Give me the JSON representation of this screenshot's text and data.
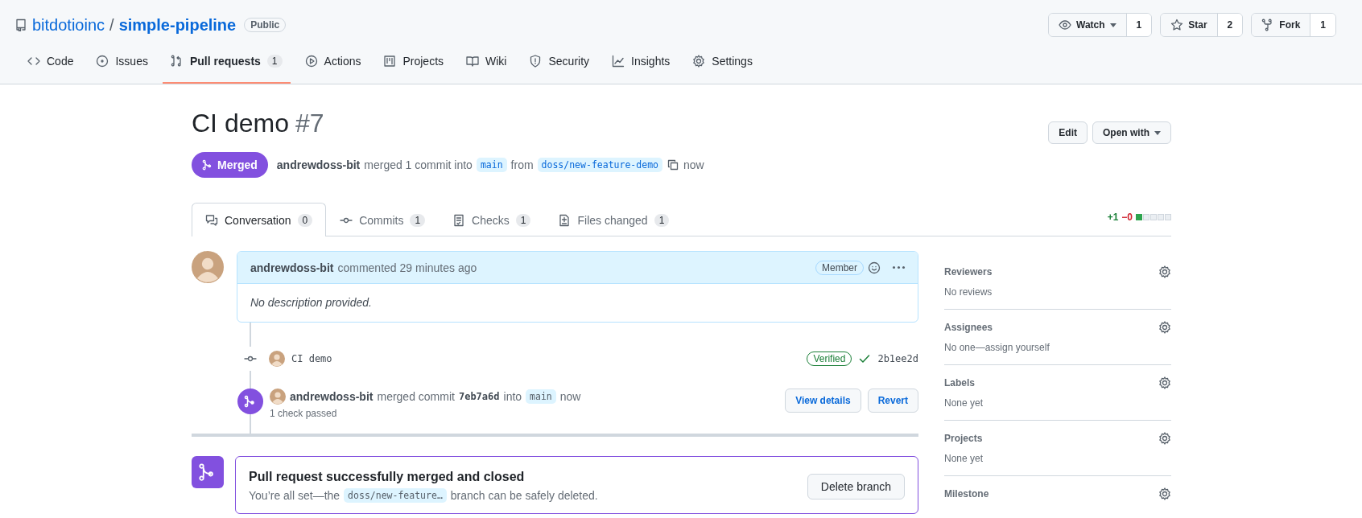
{
  "repo": {
    "owner": "bitdotioinc",
    "separator": "/",
    "name": "simple-pipeline",
    "visibility": "Public"
  },
  "repo_actions": [
    {
      "kind": "watch",
      "label": "Watch",
      "count": "1"
    },
    {
      "kind": "star",
      "label": "Star",
      "count": "2"
    },
    {
      "kind": "fork",
      "label": "Fork",
      "count": "1"
    }
  ],
  "nav_tabs": [
    {
      "kind": "code",
      "label": "Code",
      "selected": false
    },
    {
      "kind": "issues",
      "label": "Issues",
      "selected": false
    },
    {
      "kind": "pulls",
      "label": "Pull requests",
      "count": "1",
      "selected": true
    },
    {
      "kind": "actions",
      "label": "Actions",
      "selected": false
    },
    {
      "kind": "projects",
      "label": "Projects",
      "selected": false
    },
    {
      "kind": "wiki",
      "label": "Wiki",
      "selected": false
    },
    {
      "kind": "security",
      "label": "Security",
      "selected": false
    },
    {
      "kind": "insights",
      "label": "Insights",
      "selected": false
    },
    {
      "kind": "settings",
      "label": "Settings",
      "selected": false
    }
  ],
  "pr": {
    "title": "CI demo",
    "number": "#7",
    "state": "Merged",
    "author": "andrewdoss-bit",
    "action": "merged 1 commit into",
    "base": "main",
    "from": "from",
    "head": "doss/new-feature-demo",
    "time": "now"
  },
  "header_buttons": [
    {
      "kind": "edit",
      "label": "Edit"
    },
    {
      "kind": "menu",
      "label": "Open with"
    }
  ],
  "pr_tabs": [
    {
      "kind": "conversation",
      "label": "Conversation",
      "count": "0",
      "selected": true
    },
    {
      "kind": "commits",
      "label": "Commits",
      "count": "1",
      "selected": false
    },
    {
      "kind": "checks",
      "label": "Checks",
      "count": "1",
      "selected": false
    },
    {
      "kind": "files",
      "label": "Files changed",
      "count": "1",
      "selected": false
    }
  ],
  "diffstat": {
    "additions": "+1",
    "deletions": "−0",
    "blocks": [
      {
        "kind": "added"
      },
      {
        "kind": "neutral"
      },
      {
        "kind": "neutral"
      },
      {
        "kind": "neutral"
      },
      {
        "kind": "neutral"
      }
    ]
  },
  "comment": {
    "author": "andrewdoss-bit",
    "action": "commented 29 minutes ago",
    "badge": "Member",
    "body": "No description provided."
  },
  "timeline": [
    {
      "kind": "commit",
      "message": "CI demo",
      "verified": "Verified",
      "sha": "2b1ee2d"
    },
    {
      "kind": "merge",
      "author": "andrewdoss-bit",
      "verb": "merged commit",
      "commit": "7eb7a6d",
      "into": "into",
      "branch": "main",
      "time": "now",
      "checks": "1 check passed",
      "buttons": [
        "View details",
        "Revert"
      ]
    }
  ],
  "merge_box": {
    "title": "Pull request successfully merged and closed",
    "before": "You’re all set—the",
    "branch": "doss/new-feature…",
    "after": "branch can be safely deleted.",
    "button": "Delete branch"
  },
  "sidebar": [
    {
      "heading": "Reviewers",
      "value": "No reviews"
    },
    {
      "heading": "Assignees",
      "value": "No one—assign yourself"
    },
    {
      "heading": "Labels",
      "value": "None yet"
    },
    {
      "heading": "Projects",
      "value": "None yet"
    },
    {
      "heading": "Milestone"
    }
  ]
}
